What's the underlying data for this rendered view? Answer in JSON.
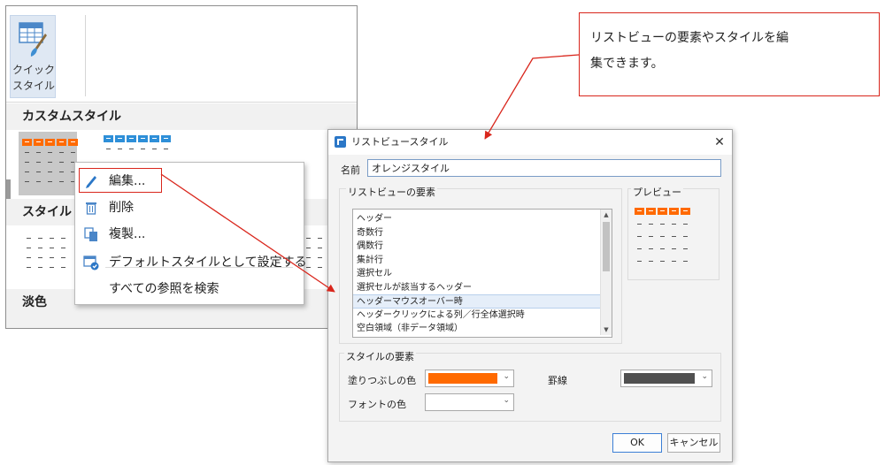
{
  "ribbon": {
    "quick_style_label_line1": "クイック",
    "quick_style_label_line2": "スタイル"
  },
  "gallery": {
    "section_custom": "カスタムスタイル",
    "section_style": "スタイル",
    "section_light": "淡色"
  },
  "context_menu": {
    "items": [
      {
        "label": "編集...",
        "icon": "pencil-icon"
      },
      {
        "label": "削除",
        "icon": "trash-icon"
      },
      {
        "label": "複製...",
        "icon": "copy-icon"
      },
      {
        "label": "デフォルトスタイルとして設定する",
        "icon": "default-style-icon"
      },
      {
        "label": "すべての参照を検索",
        "icon": ""
      }
    ]
  },
  "callout": {
    "line1": "リストビューの要素やスタイルを編",
    "line2": "集できます。"
  },
  "dialog": {
    "title": "リストビュースタイル",
    "close_glyph": "✕",
    "name_label": "名前",
    "name_value": "オレンジスタイル",
    "elements_group": "リストビューの要素",
    "elements": [
      "ヘッダー",
      "奇数行",
      "偶数行",
      "集計行",
      "選択セル",
      "選択セルが該当するヘッダー",
      "ヘッダーマウスオーバー時",
      "ヘッダークリックによる列／行全体選択時",
      "空白領域（非データ領域）"
    ],
    "selected_index": 6,
    "preview_group": "プレビュー",
    "style_group": "スタイルの要素",
    "fill_label": "塗りつぶしの色",
    "border_label": "罫線",
    "font_color_label": "フォントの色",
    "fill_color": "#ff6a00",
    "border_color": "#505050",
    "ok_label": "OK",
    "cancel_label": "キャンセル"
  },
  "colors": {
    "accent_orange": "#ff6a00",
    "accent_blue": "#2e8fd8",
    "highlight_red": "#d9261c"
  }
}
